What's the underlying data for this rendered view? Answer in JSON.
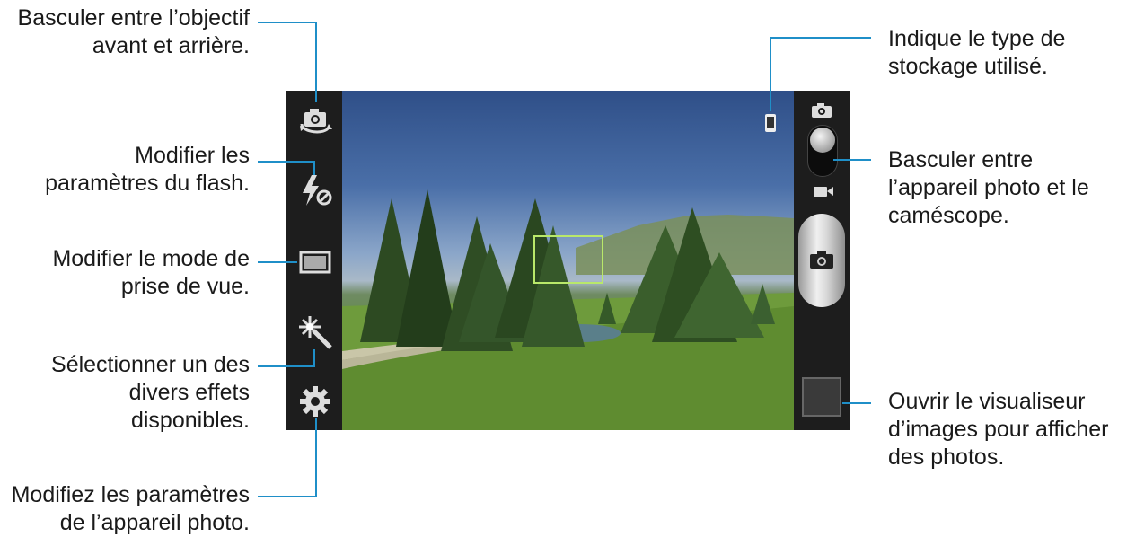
{
  "callouts": {
    "switch_lens": "Basculer entre l’objectif\navant et arrière.",
    "flash_settings": "Modifier les\nparamètres du flash.",
    "shooting_mode": "Modifier le mode de\nprise de vue.",
    "effects": "Sélectionner un des\ndivers effets\ndisponibles.",
    "camera_settings": "Modifiez les paramètres\nde l’appareil photo.",
    "storage_type": "Indique le type de\nstockage utilisé.",
    "camera_camcorder_switch": "Basculer entre\nl’appareil photo et le\ncaméscope.",
    "image_viewer": "Ouvrir le visualiseur\nd’images pour afficher\ndes photos."
  },
  "icons": {
    "switch_camera": "switch-camera-icon",
    "flash_off": "flash-off-icon",
    "shooting_mode": "shooting-mode-icon",
    "effects": "magic-wand-icon",
    "settings": "gear-icon",
    "storage": "phone-storage-icon",
    "photo_mode": "camera-icon",
    "video_mode": "video-camera-icon",
    "shutter": "shutter-camera-icon",
    "thumbnail": "image-thumbnail"
  },
  "colors": {
    "leader_line": "#1f8fc8",
    "focus_box": "#b9e86a",
    "bars": "#1d1d1d"
  }
}
